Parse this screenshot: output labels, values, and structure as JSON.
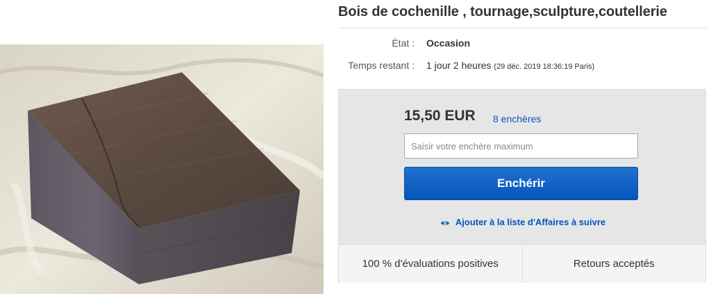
{
  "listing": {
    "title": "Bois de cochenille , tournage,sculpture,coutellerie",
    "condition_label": "État :",
    "condition_value": "Occasion",
    "time_label": "Temps restant :",
    "time_value": "1 jour 2 heures",
    "time_detail": "(29 déc. 2019   18:36:19 Paris)"
  },
  "bid_panel": {
    "price": "15,50 EUR",
    "bids_count": "8 enchères",
    "input_placeholder": "Saisir votre enchère maximum",
    "bid_button_label": "Enchérir",
    "watch_label": "Ajouter à la liste d'Affaires à suivre",
    "footer_left": "100 % d'évaluations positives",
    "footer_right": "Retours acceptés"
  },
  "colors": {
    "link_blue": "#0654ba",
    "button_blue": "#0654ba",
    "panel_grey": "#e6e6e6"
  },
  "icons": {
    "watch_icon": "eye-icon"
  }
}
